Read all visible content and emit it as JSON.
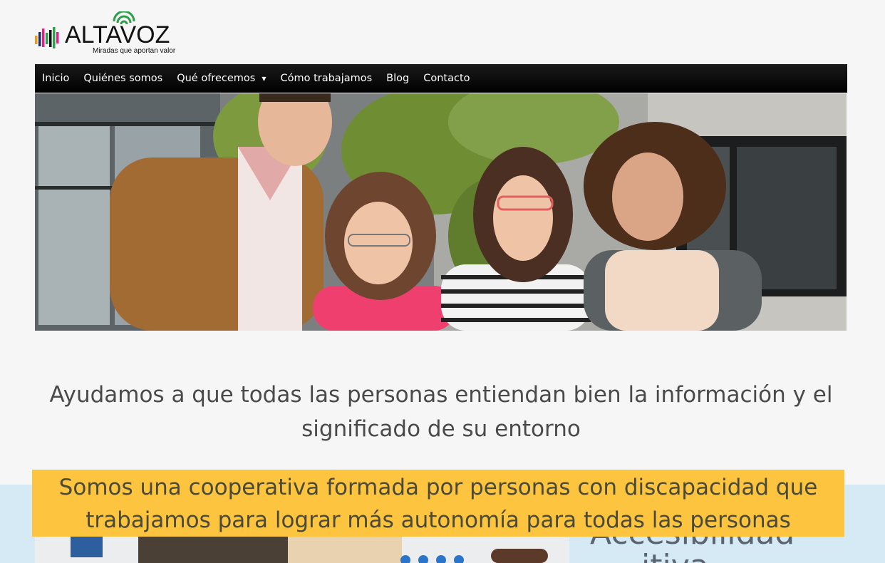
{
  "brand": {
    "name": "ALTAVOZ",
    "tagline": "Miradas que aportan valor",
    "colors": {
      "green": "#2e9e4a",
      "magenta": "#e0218a",
      "navy": "#1f2a6b",
      "black": "#111111",
      "orange": "#f39a1e"
    }
  },
  "nav": {
    "items": [
      {
        "label": "Inicio"
      },
      {
        "label": "Quiénes somos"
      },
      {
        "label": "Qué ofrecemos",
        "has_dropdown": true
      },
      {
        "label": "Cómo trabajamos"
      },
      {
        "label": "Blog"
      },
      {
        "label": "Contacto"
      }
    ]
  },
  "hero": {
    "image": "group-photo"
  },
  "headline": "Ayudamos a que todas las personas entiendan bien la información y el significado de su entorno",
  "banner": {
    "text": "Somos una cooperativa formada por personas con discapacidad que trabajamos para lograr más autonomía para todas las personas",
    "color": "#fdc43f"
  },
  "section": {
    "partial_title_line1": "Accesibilidad",
    "partial_title_line2": "itiva"
  }
}
